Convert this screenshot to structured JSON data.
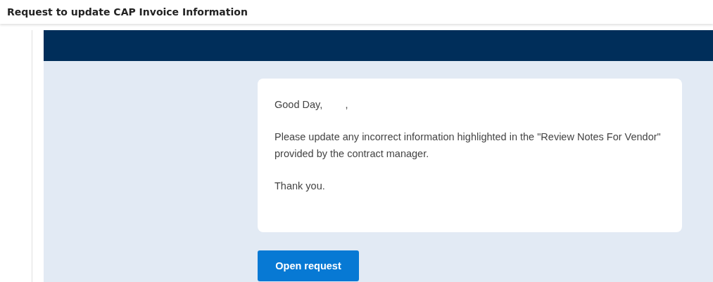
{
  "window": {
    "title": "Request to update CAP Invoice Information"
  },
  "message": {
    "paragraphs": [
      "Good Day,        ,",
      "Please update any incorrect information highlighted in the \"Review Notes For Vendor\" provided by the contract manager.",
      "Thank you."
    ]
  },
  "buttons": [
    "Open request"
  ]
}
